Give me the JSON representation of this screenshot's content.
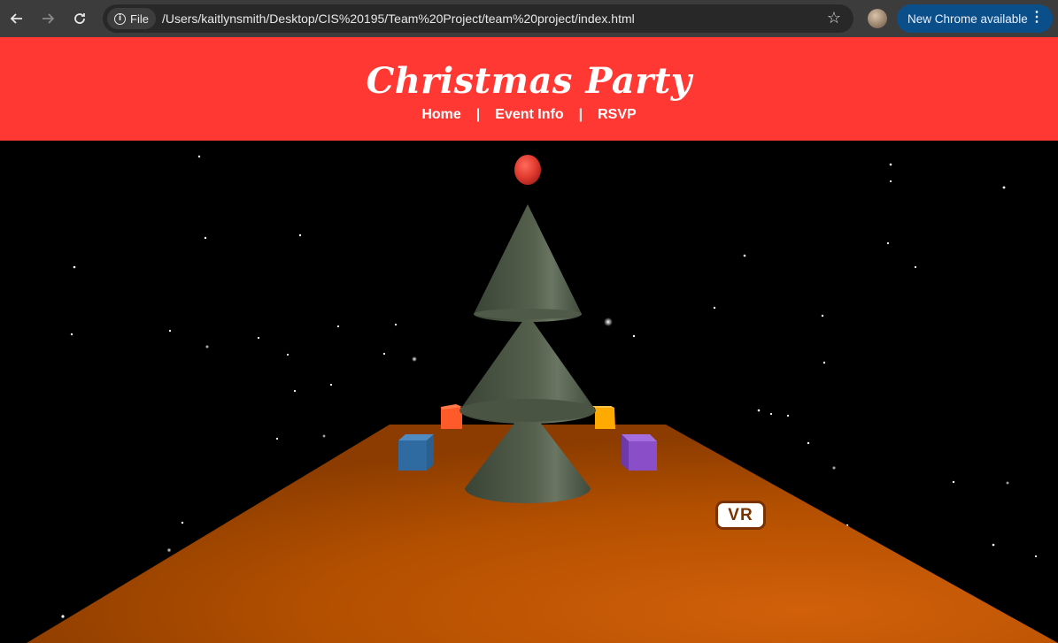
{
  "browser": {
    "back_icon": "arrow-left-icon",
    "forward_icon": "arrow-right-icon",
    "reload_icon": "reload-icon",
    "site_chip_label": "File",
    "url": "/Users/kaitlynsmith/Desktop/CIS%20195/Team%20Project/team%20project/index.html",
    "update_label": "New Chrome available"
  },
  "site": {
    "title": "Christmas Party",
    "nav": [
      {
        "label": "Home"
      },
      {
        "label": "Event Info"
      },
      {
        "label": "RSVP"
      }
    ],
    "separator": "|"
  },
  "scene": {
    "vr_button_label": "VR",
    "colors": {
      "background": "#000000",
      "floor": "#c85a00",
      "tree": "#4a5443",
      "ornament": "#e03a2e",
      "gift_red": "#ff5a2a",
      "gift_yellow": "#ffaa00",
      "gift_blue": "#2f6aa0",
      "gift_purple": "#8a4fc8"
    }
  }
}
